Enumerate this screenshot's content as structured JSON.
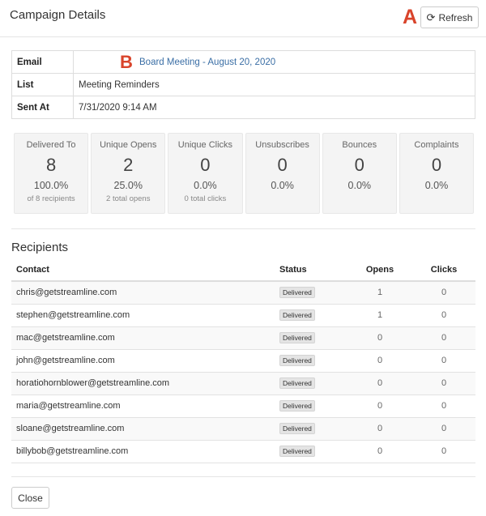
{
  "header": {
    "title": "Campaign Details",
    "marker_a": "A",
    "refresh_label": "Refresh",
    "refresh_icon": "⟳"
  },
  "info": {
    "email_label": "Email",
    "email_value": "Board Meeting - August 20, 2020",
    "marker_b": "B",
    "list_label": "List",
    "list_value": "Meeting Reminders",
    "sent_label": "Sent At",
    "sent_value": "7/31/2020 9:14 AM"
  },
  "stats": [
    {
      "label": "Delivered To",
      "count": "8",
      "pct": "100.0%",
      "sub": "of 8 recipients"
    },
    {
      "label": "Unique Opens",
      "count": "2",
      "pct": "25.0%",
      "sub": "2 total opens"
    },
    {
      "label": "Unique Clicks",
      "count": "0",
      "pct": "0.0%",
      "sub": "0 total clicks"
    },
    {
      "label": "Unsubscribes",
      "count": "0",
      "pct": "0.0%",
      "sub": ""
    },
    {
      "label": "Bounces",
      "count": "0",
      "pct": "0.0%",
      "sub": ""
    },
    {
      "label": "Complaints",
      "count": "0",
      "pct": "0.0%",
      "sub": ""
    }
  ],
  "recipients": {
    "title": "Recipients",
    "headers": {
      "contact": "Contact",
      "status": "Status",
      "opens": "Opens",
      "clicks": "Clicks"
    },
    "rows": [
      {
        "contact": "chris@getstreamline.com",
        "status": "Delivered",
        "opens": "1",
        "clicks": "0"
      },
      {
        "contact": "stephen@getstreamline.com",
        "status": "Delivered",
        "opens": "1",
        "clicks": "0"
      },
      {
        "contact": "mac@getstreamline.com",
        "status": "Delivered",
        "opens": "0",
        "clicks": "0"
      },
      {
        "contact": "john@getstreamline.com",
        "status": "Delivered",
        "opens": "0",
        "clicks": "0"
      },
      {
        "contact": "horatiohornblower@getstreamline.com",
        "status": "Delivered",
        "opens": "0",
        "clicks": "0"
      },
      {
        "contact": "maria@getstreamline.com",
        "status": "Delivered",
        "opens": "0",
        "clicks": "0"
      },
      {
        "contact": "sloane@getstreamline.com",
        "status": "Delivered",
        "opens": "0",
        "clicks": "0"
      },
      {
        "contact": "billybob@getstreamline.com",
        "status": "Delivered",
        "opens": "0",
        "clicks": "0"
      }
    ]
  },
  "footer": {
    "close_label": "Close"
  }
}
